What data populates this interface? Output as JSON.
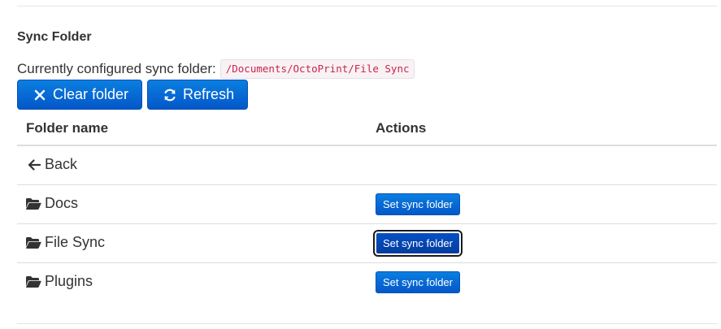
{
  "section": {
    "title": "Sync Folder",
    "current_label": "Currently configured sync folder:",
    "current_path": "/Documents/OctoPrint/File Sync"
  },
  "toolbar": {
    "clear_label": "Clear folder",
    "refresh_label": "Refresh"
  },
  "table": {
    "headers": {
      "name": "Folder name",
      "actions": "Actions"
    },
    "back_label": "Back",
    "rows": [
      {
        "name": "Docs",
        "action": "Set sync folder",
        "focused": false
      },
      {
        "name": "File Sync",
        "action": "Set sync folder",
        "focused": true
      },
      {
        "name": "Plugins",
        "action": "Set sync folder",
        "focused": false
      }
    ]
  },
  "colors": {
    "primary": "#0a7fe0",
    "primary_dark": "#0457c9",
    "code_text": "#c7254e",
    "code_bg": "#f9f2f4"
  },
  "icons": {
    "clear": "x-icon",
    "refresh": "refresh-icon",
    "back": "arrow-left-icon",
    "folder": "folder-open-icon"
  }
}
